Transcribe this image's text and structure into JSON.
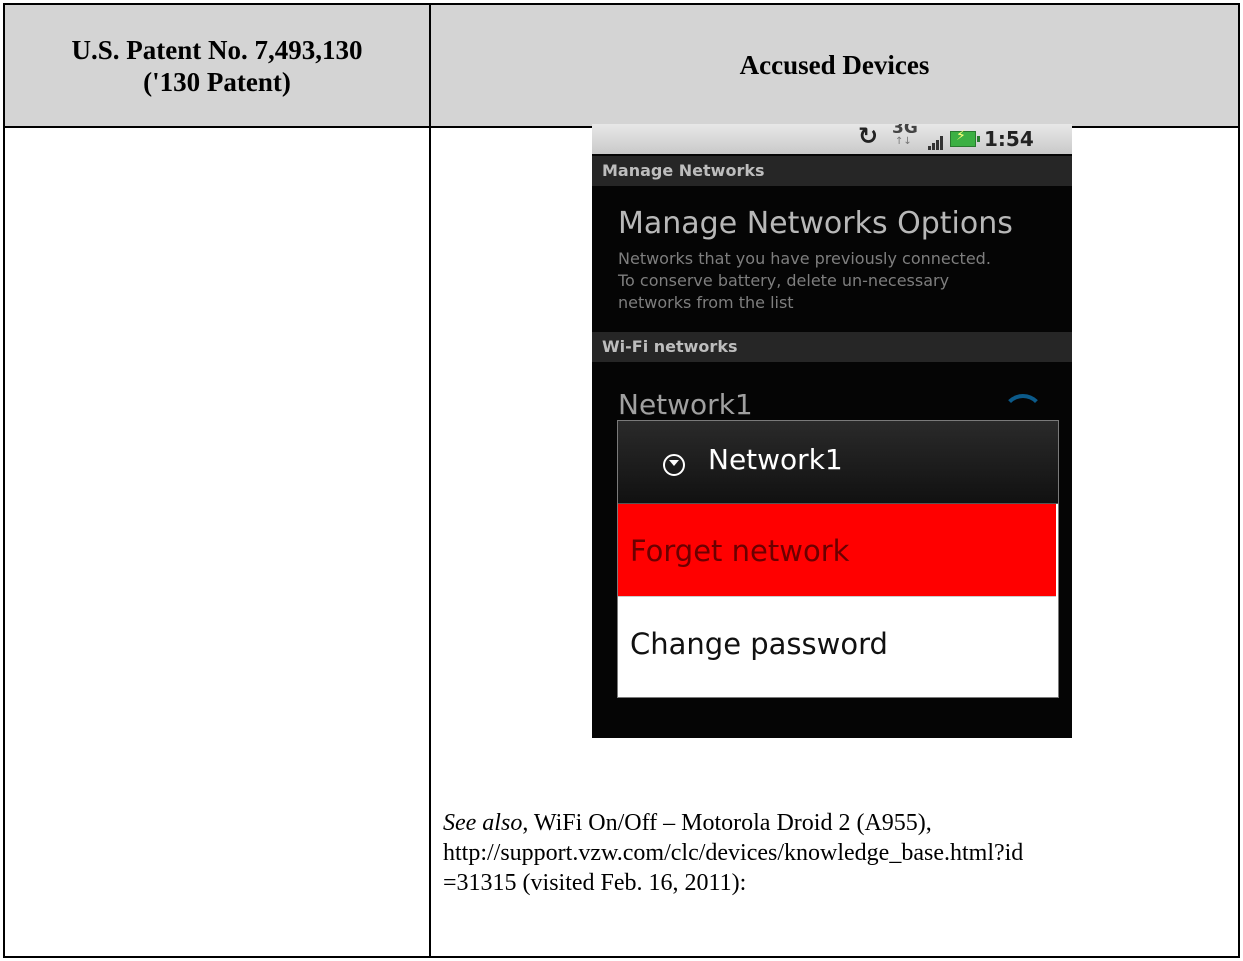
{
  "header": {
    "left_line1": "U.S. Patent No. 7,493,130",
    "left_line2": "('130 Patent)",
    "right": "Accused Devices"
  },
  "phone": {
    "status": {
      "network": "3G",
      "time": "1:54"
    },
    "section1": "Manage Networks",
    "options_title": "Manage Networks Options",
    "options_desc": "Networks that you have previously connected.\nTo conserve battery, delete un-necessary\nnetworks from the list",
    "section2": "Wi-Fi networks",
    "network_item": "Network1",
    "dialog": {
      "title": "Network1",
      "forget": "Forget network",
      "change": "Change password"
    }
  },
  "citation": {
    "see_also": "See also",
    "line1_rest": ", WiFi On/Off – Motorola Droid 2 (A955),",
    "line2": "http://support.vzw.com/clc/devices/knowledge_base.html?id",
    "line3": "=31315 (visited Feb. 16, 2011):"
  }
}
